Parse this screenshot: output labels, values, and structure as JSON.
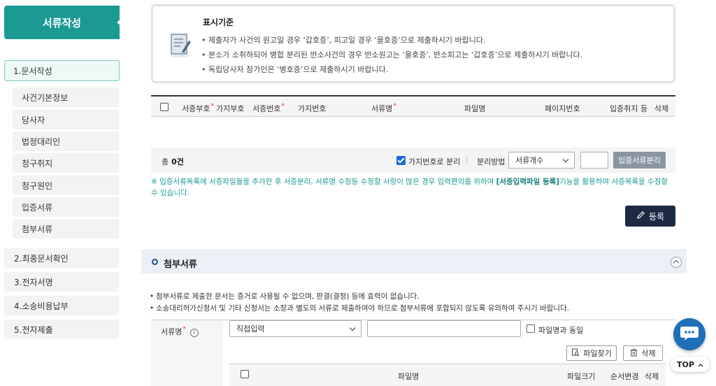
{
  "sidebar": {
    "title": "서류작성",
    "active_menu": "1.문서작성",
    "submenu": [
      "사건기본정보",
      "당사자",
      "법정대리인",
      "청구취지",
      "청구원인",
      "입증서류",
      "첨부서류"
    ],
    "menus": [
      "2.최종문서확인",
      "3.전자서명",
      "4.소송비용납부",
      "5.전자제출"
    ]
  },
  "notice": {
    "title": "표시기준",
    "lines": [
      "제출자가 사건의 원고일 경우 ‘갑호증’, 피고일 경우 ‘을호증’으로 제출하시기 바랍니다.",
      "본소가 소취하되어 병합 분리된 반소사건의 경우 반소원고는 ‘을호증’, 반소피고는 ‘갑호증’으로 제출하시기 바랍니다.",
      "독립당사자 참가인은 ‘병호증’으로 제출하시기 바랍니다."
    ]
  },
  "table": {
    "columns": [
      "서증부호",
      "가지부호",
      "서증번호",
      "가지번호",
      "서류명",
      "파일명",
      "페이지번호",
      "입증취지 등",
      "삭제"
    ],
    "required_mark": "*"
  },
  "actionbar": {
    "total_label": "총",
    "total_count": "0건",
    "branch_separate_label": "가지번호로 분리",
    "branch_separate_checked": true,
    "split_method_label": "분리방법",
    "split_method_value": "서류개수",
    "split_button": "입증서류분리"
  },
  "note": {
    "pre": "※ 입증서류목록에 서증파일들을 추가한 후 서증분리, 서류명 수정등 수정할 사항이 많은 경우 입력편의를 위하여 ",
    "bold": "[서증입력파일 등록]",
    "post": "기능을 활용하여 서증목록을 수정할 수 있습니다."
  },
  "register_button": "등록",
  "section": {
    "title": "첨부서류",
    "bullets": [
      "첨부서류로 제출한 문서는 증거로 사용될 수 없으며, 판결(결정) 등에 효력이 없습니다.",
      "소송대리허가신청서 및 기타 신청서는 소장과 별도의 서류로 제출하여야 하므로 첨부서류에 포함되지 않도록 유의하여 주시기 바랍니다."
    ]
  },
  "form": {
    "doc_name_label": "서류명",
    "doc_select_value": "직접입력",
    "same_as_filename_label": "파일명과 동일",
    "find_file_button": "파일찾기",
    "delete_button": "삭제",
    "inner_columns": [
      "파일명",
      "파일크기",
      "순서변경",
      "삭제"
    ]
  },
  "floating": {
    "top_label": "TOP"
  },
  "colors": {
    "accent": "#1a9a93",
    "navy": "#1d2a44",
    "blue": "#1e6fb8"
  }
}
